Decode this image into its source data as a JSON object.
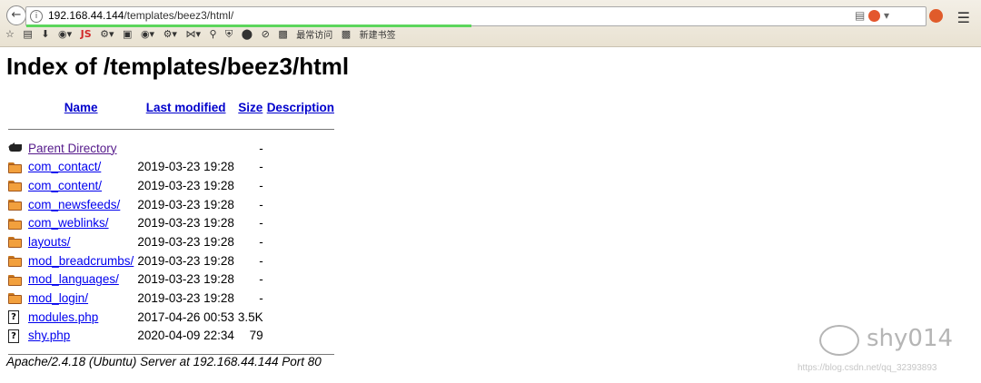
{
  "browser": {
    "url_host": "192.168.44.144",
    "url_path": "/templates/beez3/html/",
    "bookmarks": [
      {
        "label": "最常访问",
        "icon": "page-icon"
      },
      {
        "label": "新建书签",
        "icon": "page-icon"
      }
    ],
    "toolbar_js_label": "JS"
  },
  "page": {
    "title": "Index of /templates/beez3/html",
    "columns": {
      "name": "Name",
      "last_modified": "Last modified",
      "size": "Size",
      "description": "Description"
    },
    "entries": [
      {
        "icon": "back-icon",
        "name": "Parent Directory",
        "modified": "",
        "size": "-",
        "visited": true
      },
      {
        "icon": "folder-icon",
        "name": "com_contact/",
        "modified": "2019-03-23 19:28",
        "size": "-"
      },
      {
        "icon": "folder-icon",
        "name": "com_content/",
        "modified": "2019-03-23 19:28",
        "size": "-"
      },
      {
        "icon": "folder-icon",
        "name": "com_newsfeeds/",
        "modified": "2019-03-23 19:28",
        "size": "-"
      },
      {
        "icon": "folder-icon",
        "name": "com_weblinks/",
        "modified": "2019-03-23 19:28",
        "size": "-"
      },
      {
        "icon": "folder-icon",
        "name": "layouts/",
        "modified": "2019-03-23 19:28",
        "size": "-"
      },
      {
        "icon": "folder-icon",
        "name": "mod_breadcrumbs/",
        "modified": "2019-03-23 19:28",
        "size": "-"
      },
      {
        "icon": "folder-icon",
        "name": "mod_languages/",
        "modified": "2019-03-23 19:28",
        "size": "-"
      },
      {
        "icon": "folder-icon",
        "name": "mod_login/",
        "modified": "2019-03-23 19:28",
        "size": "-"
      },
      {
        "icon": "unknown-file-icon",
        "name": "modules.php",
        "modified": "2017-04-26 00:53",
        "size": "3.5K"
      },
      {
        "icon": "unknown-file-icon",
        "name": "shy.php",
        "modified": "2020-04-09 22:34",
        "size": "79"
      }
    ],
    "server_signature": "Apache/2.4.18 (Ubuntu) Server at 192.168.44.144 Port 80"
  },
  "watermark": {
    "name": "shy014",
    "url": "https://blog.csdn.net/qq_32393893"
  }
}
